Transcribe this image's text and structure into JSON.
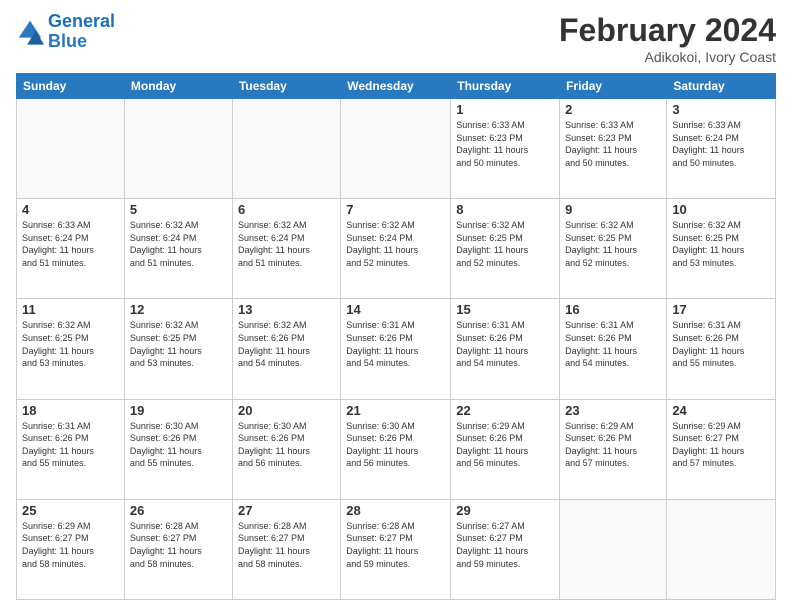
{
  "logo": {
    "line1": "General",
    "line2": "Blue"
  },
  "title": "February 2024",
  "subtitle": "Adikokoi, Ivory Coast",
  "days_header": [
    "Sunday",
    "Monday",
    "Tuesday",
    "Wednesday",
    "Thursday",
    "Friday",
    "Saturday"
  ],
  "weeks": [
    [
      {
        "day": "",
        "info": ""
      },
      {
        "day": "",
        "info": ""
      },
      {
        "day": "",
        "info": ""
      },
      {
        "day": "",
        "info": ""
      },
      {
        "day": "1",
        "info": "Sunrise: 6:33 AM\nSunset: 6:23 PM\nDaylight: 11 hours\nand 50 minutes."
      },
      {
        "day": "2",
        "info": "Sunrise: 6:33 AM\nSunset: 6:23 PM\nDaylight: 11 hours\nand 50 minutes."
      },
      {
        "day": "3",
        "info": "Sunrise: 6:33 AM\nSunset: 6:24 PM\nDaylight: 11 hours\nand 50 minutes."
      }
    ],
    [
      {
        "day": "4",
        "info": "Sunrise: 6:33 AM\nSunset: 6:24 PM\nDaylight: 11 hours\nand 51 minutes."
      },
      {
        "day": "5",
        "info": "Sunrise: 6:32 AM\nSunset: 6:24 PM\nDaylight: 11 hours\nand 51 minutes."
      },
      {
        "day": "6",
        "info": "Sunrise: 6:32 AM\nSunset: 6:24 PM\nDaylight: 11 hours\nand 51 minutes."
      },
      {
        "day": "7",
        "info": "Sunrise: 6:32 AM\nSunset: 6:24 PM\nDaylight: 11 hours\nand 52 minutes."
      },
      {
        "day": "8",
        "info": "Sunrise: 6:32 AM\nSunset: 6:25 PM\nDaylight: 11 hours\nand 52 minutes."
      },
      {
        "day": "9",
        "info": "Sunrise: 6:32 AM\nSunset: 6:25 PM\nDaylight: 11 hours\nand 52 minutes."
      },
      {
        "day": "10",
        "info": "Sunrise: 6:32 AM\nSunset: 6:25 PM\nDaylight: 11 hours\nand 53 minutes."
      }
    ],
    [
      {
        "day": "11",
        "info": "Sunrise: 6:32 AM\nSunset: 6:25 PM\nDaylight: 11 hours\nand 53 minutes."
      },
      {
        "day": "12",
        "info": "Sunrise: 6:32 AM\nSunset: 6:25 PM\nDaylight: 11 hours\nand 53 minutes."
      },
      {
        "day": "13",
        "info": "Sunrise: 6:32 AM\nSunset: 6:26 PM\nDaylight: 11 hours\nand 54 minutes."
      },
      {
        "day": "14",
        "info": "Sunrise: 6:31 AM\nSunset: 6:26 PM\nDaylight: 11 hours\nand 54 minutes."
      },
      {
        "day": "15",
        "info": "Sunrise: 6:31 AM\nSunset: 6:26 PM\nDaylight: 11 hours\nand 54 minutes."
      },
      {
        "day": "16",
        "info": "Sunrise: 6:31 AM\nSunset: 6:26 PM\nDaylight: 11 hours\nand 54 minutes."
      },
      {
        "day": "17",
        "info": "Sunrise: 6:31 AM\nSunset: 6:26 PM\nDaylight: 11 hours\nand 55 minutes."
      }
    ],
    [
      {
        "day": "18",
        "info": "Sunrise: 6:31 AM\nSunset: 6:26 PM\nDaylight: 11 hours\nand 55 minutes."
      },
      {
        "day": "19",
        "info": "Sunrise: 6:30 AM\nSunset: 6:26 PM\nDaylight: 11 hours\nand 55 minutes."
      },
      {
        "day": "20",
        "info": "Sunrise: 6:30 AM\nSunset: 6:26 PM\nDaylight: 11 hours\nand 56 minutes."
      },
      {
        "day": "21",
        "info": "Sunrise: 6:30 AM\nSunset: 6:26 PM\nDaylight: 11 hours\nand 56 minutes."
      },
      {
        "day": "22",
        "info": "Sunrise: 6:29 AM\nSunset: 6:26 PM\nDaylight: 11 hours\nand 56 minutes."
      },
      {
        "day": "23",
        "info": "Sunrise: 6:29 AM\nSunset: 6:26 PM\nDaylight: 11 hours\nand 57 minutes."
      },
      {
        "day": "24",
        "info": "Sunrise: 6:29 AM\nSunset: 6:27 PM\nDaylight: 11 hours\nand 57 minutes."
      }
    ],
    [
      {
        "day": "25",
        "info": "Sunrise: 6:29 AM\nSunset: 6:27 PM\nDaylight: 11 hours\nand 58 minutes."
      },
      {
        "day": "26",
        "info": "Sunrise: 6:28 AM\nSunset: 6:27 PM\nDaylight: 11 hours\nand 58 minutes."
      },
      {
        "day": "27",
        "info": "Sunrise: 6:28 AM\nSunset: 6:27 PM\nDaylight: 11 hours\nand 58 minutes."
      },
      {
        "day": "28",
        "info": "Sunrise: 6:28 AM\nSunset: 6:27 PM\nDaylight: 11 hours\nand 59 minutes."
      },
      {
        "day": "29",
        "info": "Sunrise: 6:27 AM\nSunset: 6:27 PM\nDaylight: 11 hours\nand 59 minutes."
      },
      {
        "day": "",
        "info": ""
      },
      {
        "day": "",
        "info": ""
      }
    ]
  ]
}
